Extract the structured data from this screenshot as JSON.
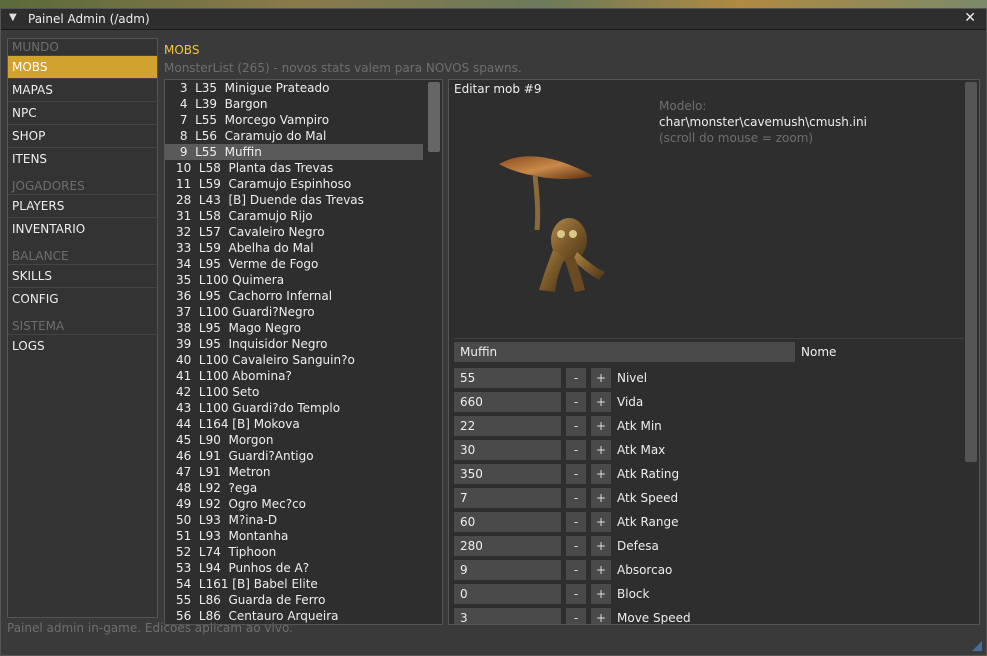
{
  "window": {
    "title": "Painel Admin  (/adm)",
    "close_glyph": "✕",
    "collapse_glyph": "▼"
  },
  "sidebar": {
    "groups": [
      {
        "heading": "MUNDO",
        "items": [
          "MOBS",
          "MAPAS",
          "NPC",
          "SHOP",
          "ITENS"
        ]
      },
      {
        "heading": "JOGADORES",
        "items": [
          "PLAYERS",
          "INVENTARIO"
        ]
      },
      {
        "heading": "BALANCE",
        "items": [
          "SKILLS",
          "CONFIG"
        ]
      },
      {
        "heading": "SISTEMA",
        "items": [
          "LOGS"
        ]
      }
    ],
    "active": "MOBS",
    "accent_color": "#d2a22f"
  },
  "section": {
    "title": "MOBS",
    "subtitle": "MonsterList (265) - novos stats valem para NOVOS spawns."
  },
  "monster_list": {
    "selected_index": 4,
    "rows": [
      " 3  L35  Minigue Prateado",
      " 4  L39  Bargon",
      " 7  L55  Morcego Vampiro",
      " 8  L56  Caramujo do Mal",
      " 9  L55  Muffin",
      "10  L58  Planta das Trevas",
      "11  L59  Caramujo Espinhoso",
      "28  L43  [B] Duende das Trevas",
      "31  L58  Caramujo Rijo",
      "32  L57  Cavaleiro Negro",
      "33  L59  Abelha do Mal",
      "34  L95  Verme de Fogo",
      "35  L100 Quimera",
      "36  L95  Cachorro Infernal",
      "37  L100 Guardi?Negro",
      "38  L95  Mago Negro",
      "39  L95  Inquisidor Negro",
      "40  L100 Cavaleiro Sanguin?o",
      "41  L100 Abomina?",
      "42  L100 Seto",
      "43  L100 Guardi?do Templo",
      "44  L164 [B] Mokova",
      "45  L90  Morgon",
      "46  L91  Guardi?Antigo",
      "47  L91  Metron",
      "48  L92  ?ega",
      "49  L92  Ogro Mec?co",
      "50  L93  M?ina-D",
      "51  L93  Montanha",
      "52  L74  Tiphoon",
      "53  L94  Punhos de A?",
      "54  L161 [B] Babel Elite",
      "55  L86  Guarda de Ferro",
      "56  L86  Centauro Arqueira"
    ]
  },
  "editor": {
    "title": "Editar mob #9",
    "model_label": "Modelo:",
    "model_path": "char\\monster\\cavemush\\cmush.ini",
    "model_hint": "(scroll do mouse = zoom)",
    "name_value": "Muffin",
    "name_label": "Nome",
    "minus_label": "-",
    "plus_label": "+",
    "stats": [
      {
        "label": "Nivel",
        "value": "55"
      },
      {
        "label": "Vida",
        "value": "660"
      },
      {
        "label": "Atk Min",
        "value": "22"
      },
      {
        "label": "Atk Max",
        "value": "30"
      },
      {
        "label": "Atk Rating",
        "value": "350"
      },
      {
        "label": "Atk Speed",
        "value": "7"
      },
      {
        "label": "Atk Range",
        "value": "60"
      },
      {
        "label": "Defesa",
        "value": "280"
      },
      {
        "label": "Absorcao",
        "value": "9"
      },
      {
        "label": "Block",
        "value": "0"
      },
      {
        "label": "Move Speed",
        "value": "3"
      }
    ]
  },
  "statusbar": {
    "text": "Painel admin in-game. Edicoes aplicam ao vivo."
  }
}
